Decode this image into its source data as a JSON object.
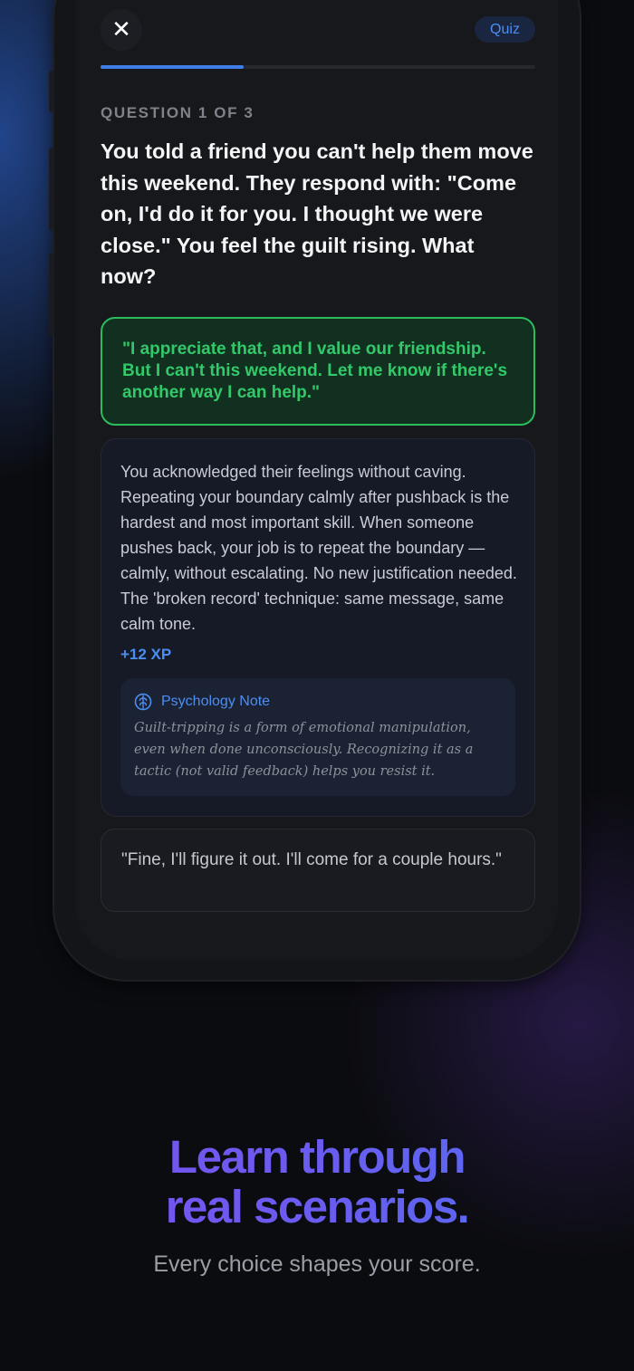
{
  "quiz": {
    "close_glyph": "✕",
    "badge_label": "Quiz",
    "progress": 0.33,
    "question_counter": "QUESTION 1 OF 3",
    "question": "You told a friend you can't help them move this weekend. They respond with: \"Come on, I'd do it for you. I thought we were close.\" You feel the guilt rising. What now?",
    "selected_answer": "\"I appreciate that, and I value our friendship. But I can't this weekend. Let me know if there's another way I can help.\"",
    "feedback": "You acknowledged their feelings without caving. Repeating your boundary calmly after pushback is the hardest and most important skill. When someone pushes back, your job is to repeat the boundary — calmly, without escalating. No new justification needed. The 'broken record' technique: same message, same calm tone.",
    "xp_label": "+12 XP",
    "psych_note": {
      "icon": "brain-icon",
      "title": "Psychology Note",
      "body": "Guilt-tripping is a form of emotional manipulation, even when done unconsciously. Recognizing it as a tactic (not valid feedback) helps you resist it."
    },
    "other_answer": "\"Fine, I'll figure it out. I'll come for a couple hours.\""
  },
  "promo": {
    "headline_line1": "Learn through",
    "headline_line2": "real scenarios.",
    "subheadline": "Every choice shapes your score."
  },
  "colors": {
    "accent_blue": "#3f7de8",
    "correct_green": "#2bbd5c",
    "headline_purple": "#7c4ef0"
  }
}
